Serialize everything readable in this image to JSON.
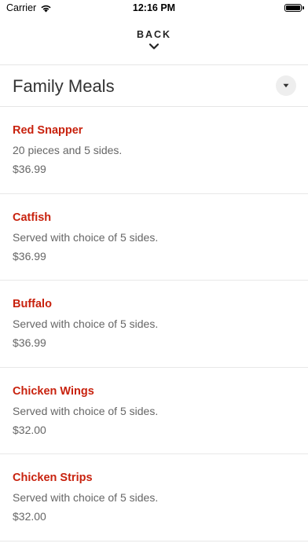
{
  "status_bar": {
    "carrier": "Carrier",
    "time": "12:16 PM"
  },
  "nav": {
    "back_label": "BACK"
  },
  "section": {
    "title": "Family Meals"
  },
  "items": [
    {
      "name": "Red Snapper",
      "description": "20 pieces and 5 sides.",
      "price": "$36.99"
    },
    {
      "name": "Catfish",
      "description": "Served with choice of 5 sides.",
      "price": "$36.99"
    },
    {
      "name": "Buffalo",
      "description": "Served with choice of 5 sides.",
      "price": "$36.99"
    },
    {
      "name": "Chicken Wings",
      "description": "Served with choice of 5 sides.",
      "price": "$32.00"
    },
    {
      "name": "Chicken Strips",
      "description": "Served with choice of 5 sides.",
      "price": "$32.00"
    }
  ],
  "colors": {
    "accent": "#c8220e",
    "text_secondary": "#666666"
  },
  "icons": {
    "wifi": "wifi-icon",
    "battery": "battery-icon",
    "back": "chevron-down-icon",
    "dropdown": "caret-down-icon"
  }
}
